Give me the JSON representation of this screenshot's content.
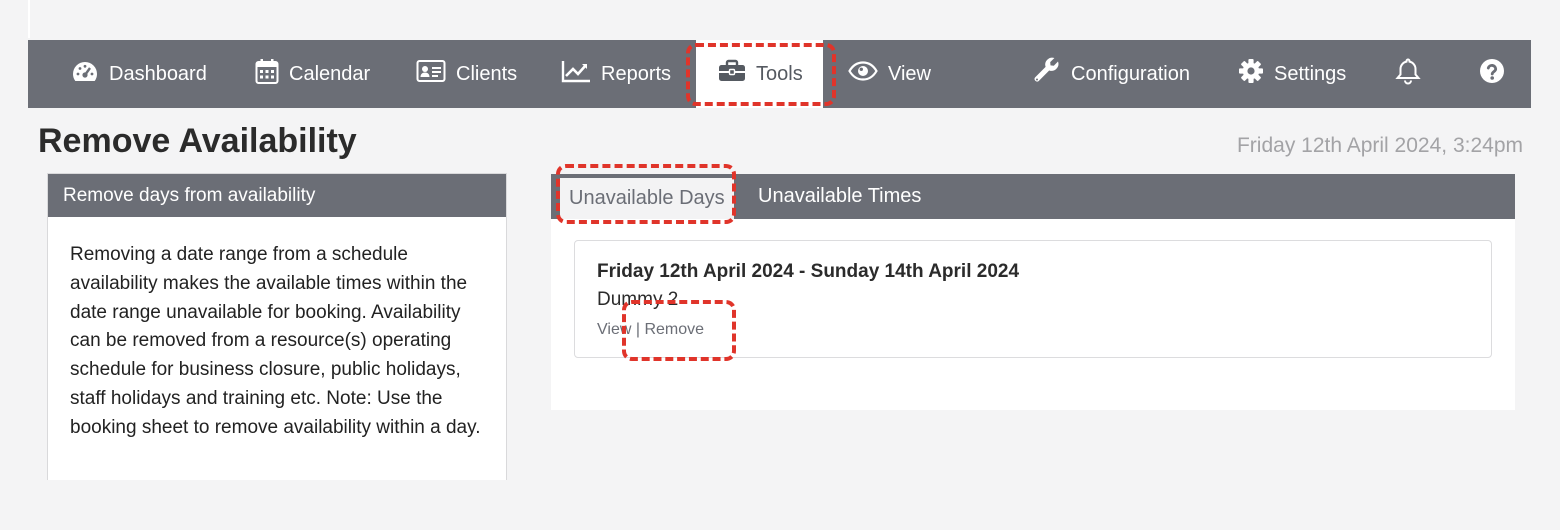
{
  "nav": {
    "items": [
      {
        "label": "Dashboard",
        "icon": "dashboard-icon"
      },
      {
        "label": "Calendar",
        "icon": "calendar-icon"
      },
      {
        "label": "Clients",
        "icon": "clients-icon"
      },
      {
        "label": "Reports",
        "icon": "reports-icon"
      },
      {
        "label": "Tools",
        "icon": "toolbox-icon"
      },
      {
        "label": "View",
        "icon": "eye-icon"
      },
      {
        "label": "Configuration",
        "icon": "wrench-icon"
      },
      {
        "label": "Settings",
        "icon": "gear-icon"
      }
    ],
    "active": "Tools",
    "notification_icon": "bell-icon",
    "help_icon": "help-icon"
  },
  "page": {
    "title": "Remove Availability",
    "datetime": "Friday 12th April 2024, 3:24pm"
  },
  "info_card": {
    "heading": "Remove days from availability",
    "body": "Removing a date range from a schedule availability makes the available times within the date range unavailable for booking. Availability can be removed from a resource(s) operating schedule for business closure, public holidays, staff holidays and training etc. Note: Use the booking sheet to remove availability within a day."
  },
  "tabs": [
    {
      "label": "Unavailable Days",
      "active": true
    },
    {
      "label": "Unavailable Times",
      "active": false
    }
  ],
  "entries": [
    {
      "date_range": "Friday 12th April 2024 - Sunday 14th April 2024",
      "name": "Dummy 2",
      "view_label": "View",
      "separator": "|",
      "remove_label": "Remove"
    }
  ],
  "colors": {
    "navbar": "#6b6e76",
    "highlight": "#e0342a",
    "background": "#f4f4f5"
  }
}
